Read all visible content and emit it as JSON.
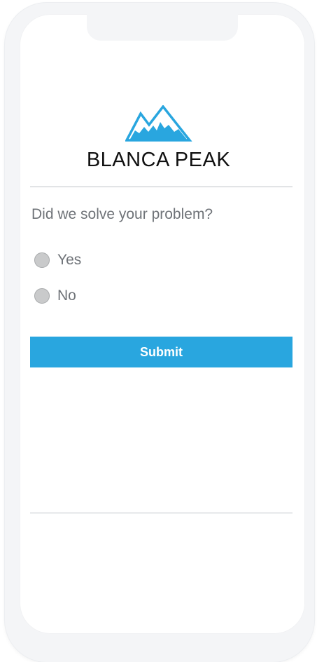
{
  "brand": {
    "name": "BLANCA PEAK",
    "logo_color": "#29a6df"
  },
  "survey": {
    "question": "Did we solve your problem?",
    "options": [
      {
        "label": "Yes",
        "selected": false
      },
      {
        "label": "No",
        "selected": false
      }
    ],
    "submit_label": "Submit"
  },
  "colors": {
    "accent": "#29a6df",
    "text_muted": "#6f7378",
    "divider": "#bfc3c8"
  }
}
